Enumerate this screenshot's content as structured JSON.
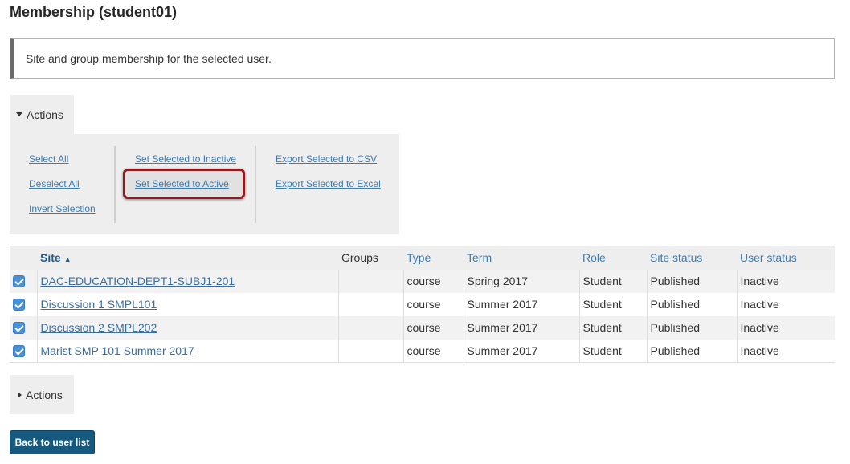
{
  "page": {
    "title": "Membership (student01)"
  },
  "info": {
    "text": "Site and group membership for the selected user."
  },
  "actions": {
    "label": "Actions",
    "select_all": "Select All",
    "deselect_all": "Deselect All",
    "invert_selection": "Invert Selection",
    "set_inactive": "Set Selected to Inactive",
    "set_active": "Set Selected to Active",
    "export_csv": "Export Selected to CSV",
    "export_excel": "Export Selected to Excel"
  },
  "table": {
    "headers": {
      "site": "Site",
      "groups": "Groups",
      "type": "Type",
      "term": "Term",
      "role": "Role",
      "site_status": "Site status",
      "user_status": "User status"
    },
    "rows": [
      {
        "checked": true,
        "site": "DAC-EDUCATION-DEPT1-SUBJ1-201",
        "groups": "",
        "type": "course",
        "term": "Spring 2017",
        "role": "Student",
        "site_status": "Published",
        "user_status": "Inactive"
      },
      {
        "checked": true,
        "site": "Discussion 1 SMPL101",
        "groups": "",
        "type": "course",
        "term": "Summer 2017",
        "role": "Student",
        "site_status": "Published",
        "user_status": "Inactive"
      },
      {
        "checked": true,
        "site": "Discussion 2 SMPL202",
        "groups": "",
        "type": "course",
        "term": "Summer 2017",
        "role": "Student",
        "site_status": "Published",
        "user_status": "Inactive"
      },
      {
        "checked": true,
        "site": "Marist SMP 101 Summer 2017",
        "groups": "",
        "type": "course",
        "term": "Summer 2017",
        "role": "Student",
        "site_status": "Published",
        "user_status": "Inactive"
      }
    ]
  },
  "footer": {
    "back_label": "Back to user list"
  },
  "colors": {
    "link": "#3b7cb3",
    "highlight_border": "#8f1a20",
    "button_bg": "#15597f",
    "panel_bg": "#eeeeee"
  }
}
